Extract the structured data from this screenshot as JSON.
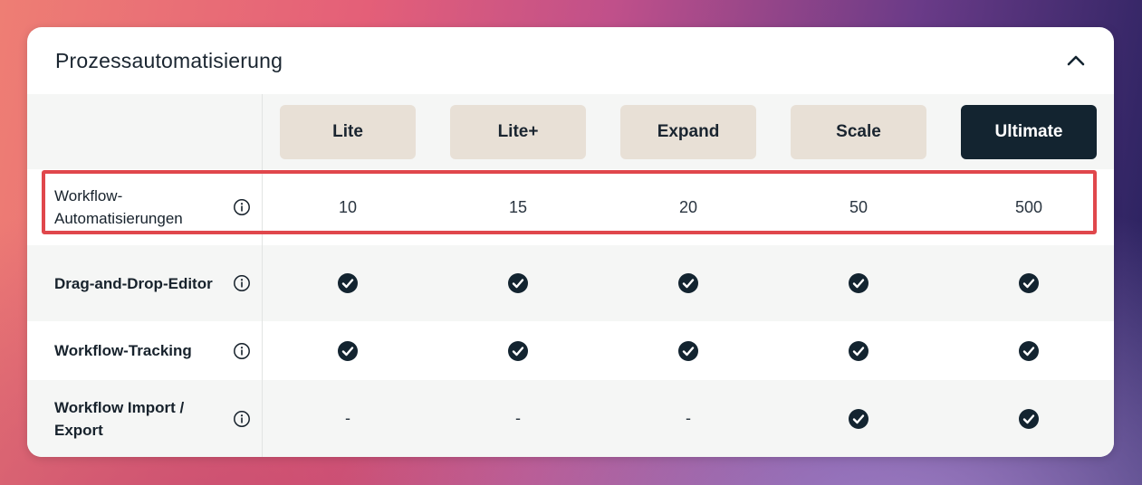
{
  "section": {
    "title": "Prozessautomatisierung"
  },
  "plans": [
    {
      "label": "Lite"
    },
    {
      "label": "Lite+"
    },
    {
      "label": "Expand"
    },
    {
      "label": "Scale"
    },
    {
      "label": "Ultimate"
    }
  ],
  "features": [
    {
      "label": "Workflow-Automatisierungen",
      "values": [
        "10",
        "15",
        "20",
        "50",
        "500"
      ]
    },
    {
      "label": "Drag-and-Drop-Editor",
      "values": [
        "check",
        "check",
        "check",
        "check",
        "check"
      ]
    },
    {
      "label": "Workflow-Tracking",
      "values": [
        "check",
        "check",
        "check",
        "check",
        "check"
      ]
    },
    {
      "label": "Workflow Import / Export",
      "values": [
        "-",
        "-",
        "-",
        "check",
        "check"
      ]
    }
  ],
  "colors": {
    "highlight": "#e0474c",
    "plan_button": "#e8e0d6",
    "plan_button_selected": "#132430",
    "text_dark": "#17222c"
  },
  "icons": {
    "collapse": "chevron-up-icon",
    "info": "info-icon",
    "check": "check-circle-icon"
  }
}
